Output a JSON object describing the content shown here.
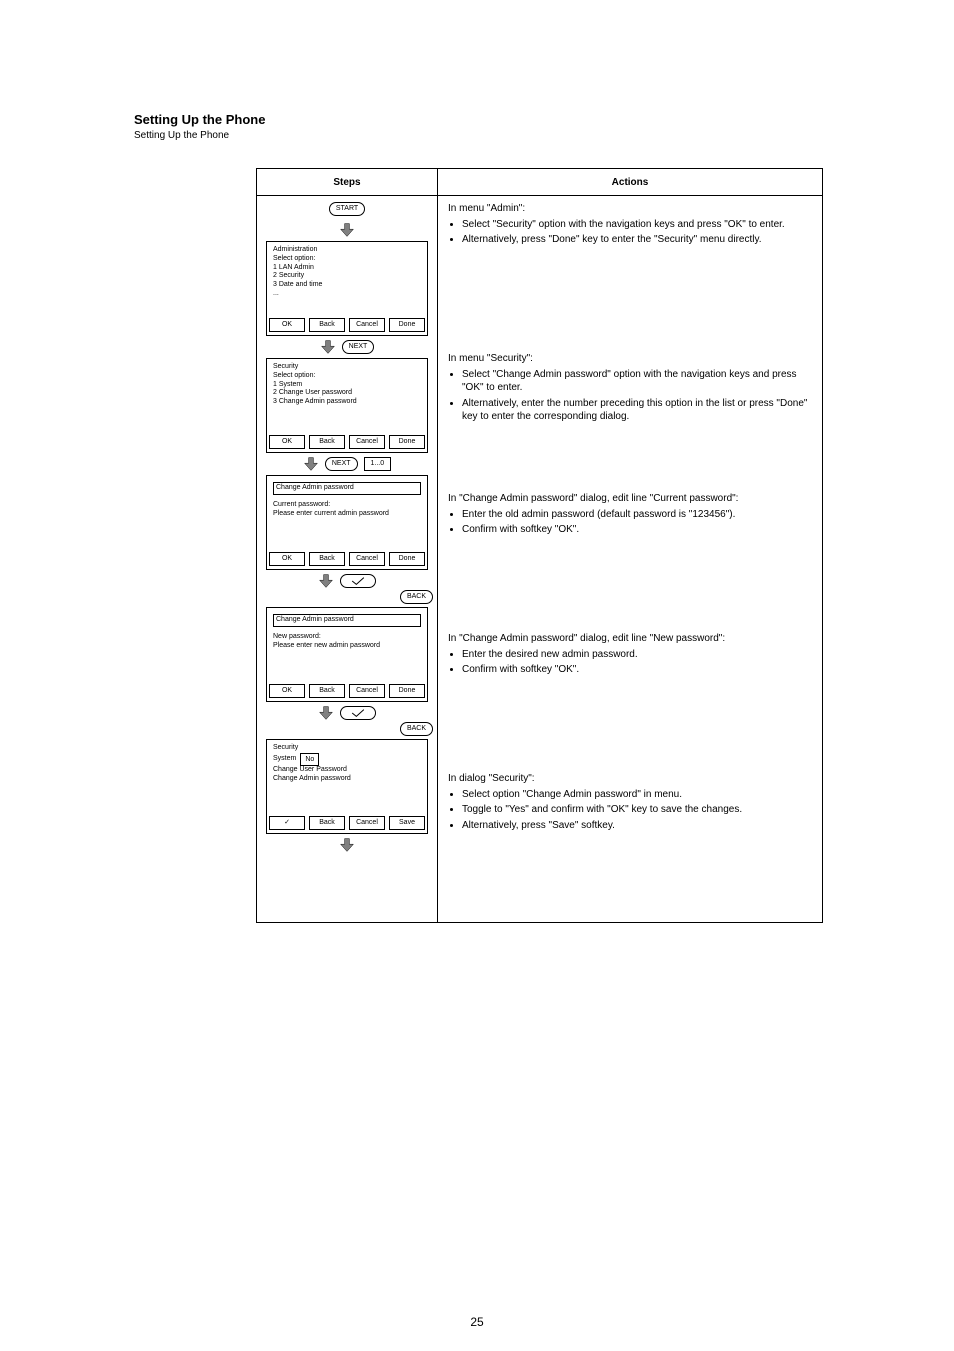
{
  "page_number": "25",
  "title": "Setting Up the Phone",
  "subtitle": "Setting Up the Phone",
  "header": {
    "col1": "Steps",
    "col2": "Actions"
  },
  "initial_pill": "START",
  "rows": [
    {
      "screen": {
        "lines": [
          "Administration",
          "Select option:",
          "1 LAN Admin",
          "2 Security",
          "3 Date and time",
          "..."
        ],
        "softkeys": [
          "OK",
          "Back",
          "Cancel",
          "Done"
        ]
      },
      "between": {
        "extras": [
          {
            "type": "pill",
            "text": "NEXT"
          }
        ]
      },
      "desc": {
        "lead": "In menu \"Admin\":",
        "items": [
          "Select \"Security\" option with the navigation keys and press \"OK\" to enter.",
          "Alternatively, press \"Done\" key to enter the \"Security\" menu directly."
        ]
      }
    },
    {
      "screen": {
        "lines": [
          "Security",
          "Select option:",
          "1 System",
          "2 Change User password",
          "3 Change Admin password"
        ],
        "softkeys": [
          "OK",
          "Back",
          "Cancel",
          "Done"
        ]
      },
      "between": {
        "extras": [
          {
            "type": "pill",
            "text": "NEXT"
          },
          {
            "type": "rect",
            "text": "1...0"
          }
        ]
      },
      "desc": {
        "lead": "In menu \"Security\":",
        "items": [
          "Select \"Change Admin password\" option with the navigation keys and press \"OK\" to enter.",
          "Alternatively, enter the number preceding this option in the list or press \"Done\" key to enter the corresponding dialog."
        ]
      }
    },
    {
      "screen": {
        "title_bar": "Change Admin password",
        "lines": [
          "Current password:",
          "Please enter current admin password"
        ],
        "softkeys": [
          "OK",
          "Back",
          "Cancel",
          "Done"
        ]
      },
      "between": {
        "extras": [
          {
            "type": "check"
          },
          {
            "type": "pill_below",
            "text": "BACK"
          }
        ]
      },
      "desc": {
        "lead": "In \"Change Admin password\" dialog, edit line \"Current password\":",
        "items": [
          "Enter the old admin password (default password is \"123456\").",
          "Confirm with softkey \"OK\"."
        ]
      }
    },
    {
      "screen": {
        "title_bar": "Change Admin password",
        "lines": [
          "New password:",
          "Please enter new admin password"
        ],
        "softkeys": [
          "OK",
          "Back",
          "Cancel",
          "Done"
        ]
      },
      "between": {
        "extras": [
          {
            "type": "check"
          },
          {
            "type": "pill_below",
            "text": "BACK"
          }
        ]
      },
      "desc": {
        "lead": "In \"Change Admin password\" dialog, edit line \"New password\":",
        "items": [
          "Enter the desired new admin password.",
          "Confirm with softkey \"OK\"."
        ]
      }
    },
    {
      "screen": {
        "lines_custom": true,
        "line1": "Security",
        "line2_prefix": "System",
        "line2_box": "No",
        "line3": "Change User Password",
        "line4": "Change Admin password",
        "softkeys": [
          "✓",
          "Back",
          "Cancel",
          "Save"
        ]
      },
      "between": {
        "extras": []
      },
      "desc": {
        "lead": "In dialog \"Security\":",
        "items": [
          "Select option \"Change Admin password\" in menu.",
          "Toggle to \"Yes\" and confirm with \"OK\" key to save the changes.",
          "Alternatively, press \"Save\" softkey."
        ]
      }
    }
  ]
}
